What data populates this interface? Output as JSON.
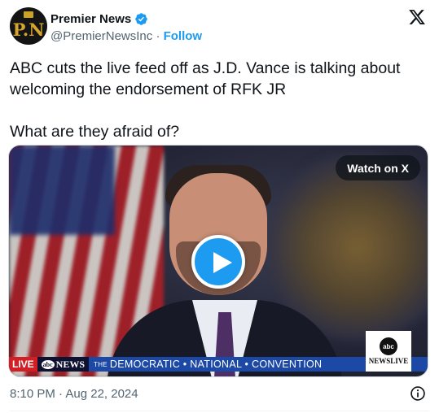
{
  "author": {
    "avatar_initials": "P.N",
    "name": "Premier News",
    "handle": "@PremierNewsInc",
    "separator": "·",
    "follow_label": "Follow",
    "verified_color": "#1d9bf0"
  },
  "post": {
    "text_line1": "ABC cuts the live feed off as J.D. Vance is talking about welcoming the endorsement of RFK JR",
    "text_line2": "What are they afraid of?"
  },
  "media": {
    "watch_label": "Watch on X",
    "live_label": "LIVE",
    "network_label": "NEWS",
    "network_logo_text": "abc",
    "banner_the": "THE",
    "banner_text": "DEMOCRATIC • NATIONAL • CONVENTION",
    "bug_logo_text": "abc",
    "bug_label": "NEWSLIVE"
  },
  "footer": {
    "timestamp": "8:10 PM · Aug 22, 2024"
  },
  "icons": {
    "x_logo": "x-logo-icon",
    "verified": "verified-badge-icon",
    "play": "play-icon",
    "info": "info-icon"
  },
  "colors": {
    "accent": "#1d9bf0",
    "text": "#0f1419",
    "secondary": "#536471",
    "live_red": "#d21f26",
    "banner_blue": "#1c49a6"
  }
}
